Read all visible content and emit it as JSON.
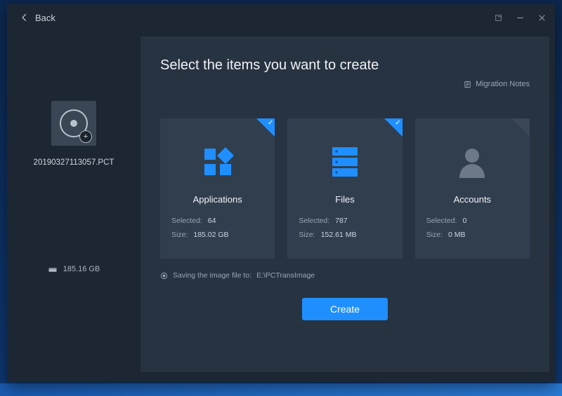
{
  "header": {
    "back_label": "Back"
  },
  "sidebar": {
    "image_filename": "20190327113057.PCT",
    "disk_capacity": "185.16 GB"
  },
  "main": {
    "heading": "Select the items you want to create",
    "migration_notes_label": "Migration Notes",
    "save_prefix": "Saving the image file to:",
    "save_path": "E:\\PCTransImage",
    "create_label": "Create"
  },
  "cards": [
    {
      "id": "applications",
      "title": "Applications",
      "selected_label": "Selected",
      "selected_value": "64",
      "size_label": "Size",
      "size_value": "185.02 GB",
      "checked": true
    },
    {
      "id": "files",
      "title": "Files",
      "selected_label": "Selected",
      "selected_value": "787",
      "size_label": "Size",
      "size_value": "152.61 MB",
      "checked": true
    },
    {
      "id": "accounts",
      "title": "Accounts",
      "selected_label": "Selected",
      "selected_value": "0",
      "size_label": "Size",
      "size_value": "0 MB",
      "checked": false
    }
  ]
}
